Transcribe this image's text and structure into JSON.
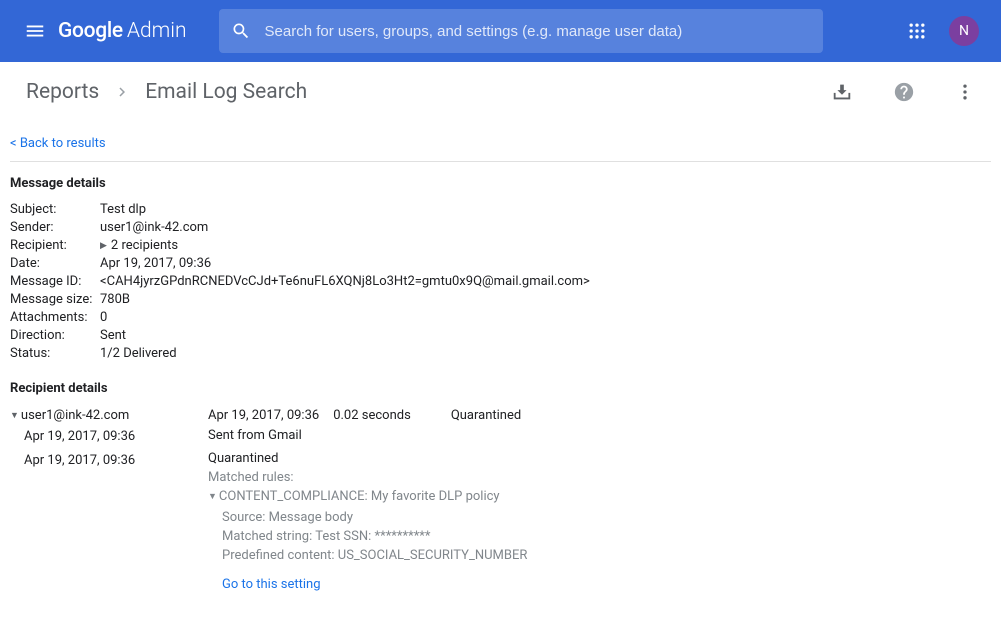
{
  "header": {
    "logo_google": "Google",
    "logo_admin": "Admin",
    "search_placeholder": "Search for users, groups, and settings (e.g. manage user data)",
    "avatar_initial": "N"
  },
  "breadcrumb": {
    "item1": "Reports",
    "item2": "Email Log Search"
  },
  "back_link": "< Back to results",
  "message_details": {
    "title": "Message details",
    "rows": {
      "subject_label": "Subject:",
      "subject_value": "Test dlp",
      "sender_label": "Sender:",
      "sender_value": "user1@ink-42.com",
      "recipient_label": "Recipient:",
      "recipient_value": "2 recipients",
      "date_label": "Date:",
      "date_value": "Apr 19, 2017, 09:36",
      "msgid_label": "Message ID:",
      "msgid_value": "<CAH4jyrzGPdnRCNEDVcCJd+Te6nuFL6XQNj8Lo3Ht2=gmtu0x9Q@mail.gmail.com>",
      "size_label": "Message size:",
      "size_value": "780B",
      "attach_label": "Attachments:",
      "attach_value": "0",
      "dir_label": "Direction:",
      "dir_value": "Sent",
      "status_label": "Status:",
      "status_value": "1/2 Delivered"
    }
  },
  "recipient_details": {
    "title": "Recipient details",
    "left": {
      "recipient": "user1@ink-42.com",
      "ts1": "Apr 19, 2017, 09:36",
      "ts2": "Apr 19, 2017, 09:36"
    },
    "right": {
      "top_date": "Apr 19, 2017, 09:36",
      "top_dur": "0.02 seconds",
      "top_status": "Quarantined",
      "sent_from": "Sent from Gmail",
      "quarantined": "Quarantined",
      "matched_rules": "Matched rules:",
      "rule": "CONTENT_COMPLIANCE: My favorite DLP policy",
      "source": "Source: Message body",
      "matched_string": "Matched string: Test SSN: **********",
      "predefined": "Predefined content: US_SOCIAL_SECURITY_NUMBER",
      "go_link": "Go to this setting"
    }
  }
}
